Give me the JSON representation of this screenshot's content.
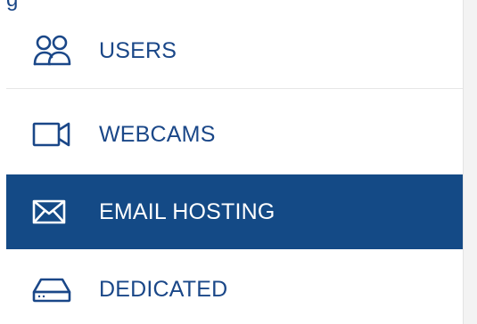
{
  "fragment_text": "g",
  "sidebar": {
    "items": [
      {
        "label": "USERS",
        "icon": "users-icon",
        "active": false
      },
      {
        "label": "WEBCAMS",
        "icon": "webcam-icon",
        "active": false
      },
      {
        "label": "EMAIL HOSTING",
        "icon": "envelope-icon",
        "active": true
      },
      {
        "label": "DEDICATED",
        "icon": "server-drive-icon",
        "active": false
      }
    ]
  },
  "colors": {
    "brand": "#1a4788",
    "active_background": "#144a86",
    "active_text": "#ffffff"
  }
}
